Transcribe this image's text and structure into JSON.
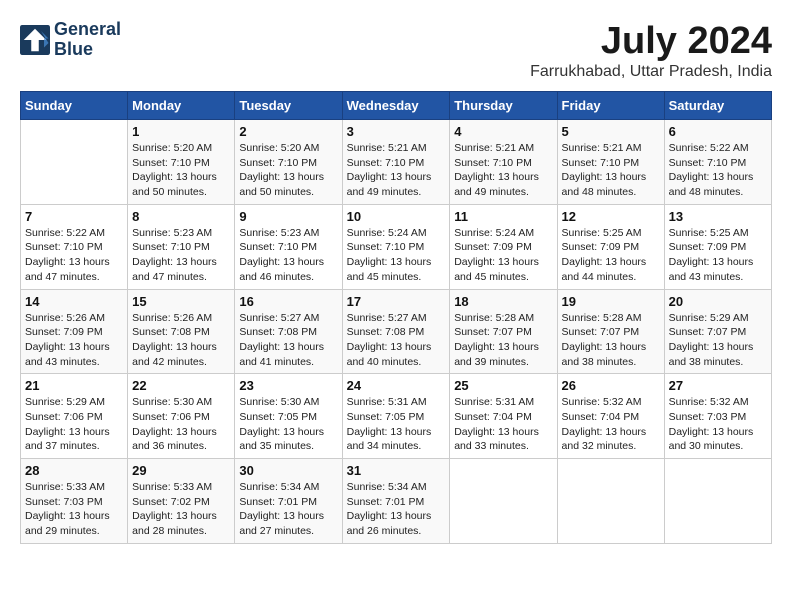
{
  "header": {
    "logo_line1": "General",
    "logo_line2": "Blue",
    "main_title": "July 2024",
    "subtitle": "Farrukhabad, Uttar Pradesh, India"
  },
  "columns": [
    "Sunday",
    "Monday",
    "Tuesday",
    "Wednesday",
    "Thursday",
    "Friday",
    "Saturday"
  ],
  "weeks": [
    [
      {
        "day": "",
        "info": ""
      },
      {
        "day": "1",
        "info": "Sunrise: 5:20 AM\nSunset: 7:10 PM\nDaylight: 13 hours\nand 50 minutes."
      },
      {
        "day": "2",
        "info": "Sunrise: 5:20 AM\nSunset: 7:10 PM\nDaylight: 13 hours\nand 50 minutes."
      },
      {
        "day": "3",
        "info": "Sunrise: 5:21 AM\nSunset: 7:10 PM\nDaylight: 13 hours\nand 49 minutes."
      },
      {
        "day": "4",
        "info": "Sunrise: 5:21 AM\nSunset: 7:10 PM\nDaylight: 13 hours\nand 49 minutes."
      },
      {
        "day": "5",
        "info": "Sunrise: 5:21 AM\nSunset: 7:10 PM\nDaylight: 13 hours\nand 48 minutes."
      },
      {
        "day": "6",
        "info": "Sunrise: 5:22 AM\nSunset: 7:10 PM\nDaylight: 13 hours\nand 48 minutes."
      }
    ],
    [
      {
        "day": "7",
        "info": "Sunrise: 5:22 AM\nSunset: 7:10 PM\nDaylight: 13 hours\nand 47 minutes."
      },
      {
        "day": "8",
        "info": "Sunrise: 5:23 AM\nSunset: 7:10 PM\nDaylight: 13 hours\nand 47 minutes."
      },
      {
        "day": "9",
        "info": "Sunrise: 5:23 AM\nSunset: 7:10 PM\nDaylight: 13 hours\nand 46 minutes."
      },
      {
        "day": "10",
        "info": "Sunrise: 5:24 AM\nSunset: 7:10 PM\nDaylight: 13 hours\nand 45 minutes."
      },
      {
        "day": "11",
        "info": "Sunrise: 5:24 AM\nSunset: 7:09 PM\nDaylight: 13 hours\nand 45 minutes."
      },
      {
        "day": "12",
        "info": "Sunrise: 5:25 AM\nSunset: 7:09 PM\nDaylight: 13 hours\nand 44 minutes."
      },
      {
        "day": "13",
        "info": "Sunrise: 5:25 AM\nSunset: 7:09 PM\nDaylight: 13 hours\nand 43 minutes."
      }
    ],
    [
      {
        "day": "14",
        "info": "Sunrise: 5:26 AM\nSunset: 7:09 PM\nDaylight: 13 hours\nand 43 minutes."
      },
      {
        "day": "15",
        "info": "Sunrise: 5:26 AM\nSunset: 7:08 PM\nDaylight: 13 hours\nand 42 minutes."
      },
      {
        "day": "16",
        "info": "Sunrise: 5:27 AM\nSunset: 7:08 PM\nDaylight: 13 hours\nand 41 minutes."
      },
      {
        "day": "17",
        "info": "Sunrise: 5:27 AM\nSunset: 7:08 PM\nDaylight: 13 hours\nand 40 minutes."
      },
      {
        "day": "18",
        "info": "Sunrise: 5:28 AM\nSunset: 7:07 PM\nDaylight: 13 hours\nand 39 minutes."
      },
      {
        "day": "19",
        "info": "Sunrise: 5:28 AM\nSunset: 7:07 PM\nDaylight: 13 hours\nand 38 minutes."
      },
      {
        "day": "20",
        "info": "Sunrise: 5:29 AM\nSunset: 7:07 PM\nDaylight: 13 hours\nand 38 minutes."
      }
    ],
    [
      {
        "day": "21",
        "info": "Sunrise: 5:29 AM\nSunset: 7:06 PM\nDaylight: 13 hours\nand 37 minutes."
      },
      {
        "day": "22",
        "info": "Sunrise: 5:30 AM\nSunset: 7:06 PM\nDaylight: 13 hours\nand 36 minutes."
      },
      {
        "day": "23",
        "info": "Sunrise: 5:30 AM\nSunset: 7:05 PM\nDaylight: 13 hours\nand 35 minutes."
      },
      {
        "day": "24",
        "info": "Sunrise: 5:31 AM\nSunset: 7:05 PM\nDaylight: 13 hours\nand 34 minutes."
      },
      {
        "day": "25",
        "info": "Sunrise: 5:31 AM\nSunset: 7:04 PM\nDaylight: 13 hours\nand 33 minutes."
      },
      {
        "day": "26",
        "info": "Sunrise: 5:32 AM\nSunset: 7:04 PM\nDaylight: 13 hours\nand 32 minutes."
      },
      {
        "day": "27",
        "info": "Sunrise: 5:32 AM\nSunset: 7:03 PM\nDaylight: 13 hours\nand 30 minutes."
      }
    ],
    [
      {
        "day": "28",
        "info": "Sunrise: 5:33 AM\nSunset: 7:03 PM\nDaylight: 13 hours\nand 29 minutes."
      },
      {
        "day": "29",
        "info": "Sunrise: 5:33 AM\nSunset: 7:02 PM\nDaylight: 13 hours\nand 28 minutes."
      },
      {
        "day": "30",
        "info": "Sunrise: 5:34 AM\nSunset: 7:01 PM\nDaylight: 13 hours\nand 27 minutes."
      },
      {
        "day": "31",
        "info": "Sunrise: 5:34 AM\nSunset: 7:01 PM\nDaylight: 13 hours\nand 26 minutes."
      },
      {
        "day": "",
        "info": ""
      },
      {
        "day": "",
        "info": ""
      },
      {
        "day": "",
        "info": ""
      }
    ]
  ]
}
